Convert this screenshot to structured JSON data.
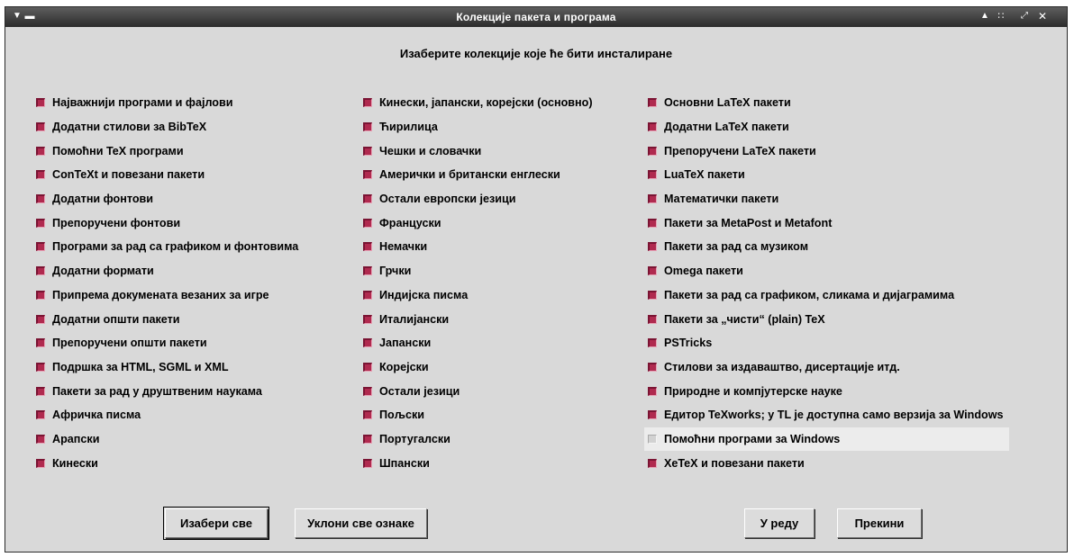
{
  "window": {
    "title": "Колекције пакета и програма",
    "controls": [
      "minimize",
      "maximize",
      "close"
    ]
  },
  "heading": "Изаберите колекције које ће бити инсталиране",
  "columns": [
    [
      {
        "label": "Најважнији програми и фајлови",
        "checked": true
      },
      {
        "label": "Додатни стилови за BibTeX",
        "checked": true
      },
      {
        "label": "Помоћни TeX програми",
        "checked": true
      },
      {
        "label": "ConTeXt и повезани пакети",
        "checked": true
      },
      {
        "label": "Додатни фонтови",
        "checked": true
      },
      {
        "label": "Препоручени фонтови",
        "checked": true
      },
      {
        "label": "Програми за рад са графиком и фонтовима",
        "checked": true
      },
      {
        "label": "Додатни формати",
        "checked": true
      },
      {
        "label": "Припрема докумената везаних за игре",
        "checked": true
      },
      {
        "label": "Додатни општи пакети",
        "checked": true
      },
      {
        "label": "Препоручени општи пакети",
        "checked": true
      },
      {
        "label": "Подршка за HTML, SGML и XML",
        "checked": true
      },
      {
        "label": "Пакети за рад у друштвеним наукама",
        "checked": true
      },
      {
        "label": "Афричка писма",
        "checked": true
      },
      {
        "label": "Арапски",
        "checked": true
      },
      {
        "label": "Кинески",
        "checked": true
      }
    ],
    [
      {
        "label": "Кинески, јапански, корејски (основно)",
        "checked": true
      },
      {
        "label": "Ћирилица",
        "checked": true
      },
      {
        "label": "Чешки и словачки",
        "checked": true
      },
      {
        "label": "Амерички и британски енглески",
        "checked": true
      },
      {
        "label": "Остали европски језици",
        "checked": true
      },
      {
        "label": "Француски",
        "checked": true
      },
      {
        "label": "Немачки",
        "checked": true
      },
      {
        "label": "Грчки",
        "checked": true
      },
      {
        "label": "Индијска писма",
        "checked": true
      },
      {
        "label": "Италијански",
        "checked": true
      },
      {
        "label": "Јапански",
        "checked": true
      },
      {
        "label": "Корејски",
        "checked": true
      },
      {
        "label": "Остали језици",
        "checked": true
      },
      {
        "label": "Пољски",
        "checked": true
      },
      {
        "label": "Португалски",
        "checked": true
      },
      {
        "label": "Шпански",
        "checked": true
      }
    ],
    [
      {
        "label": "Основни LaTeX пакети",
        "checked": true
      },
      {
        "label": "Додатни LaTeX пакети",
        "checked": true
      },
      {
        "label": "Препоручени LaTeX пакети",
        "checked": true
      },
      {
        "label": "LuaTeX пакети",
        "checked": true
      },
      {
        "label": "Математички пакети",
        "checked": true
      },
      {
        "label": "Пакети за MetaPost и Metafont",
        "checked": true
      },
      {
        "label": "Пакети за рад са музиком",
        "checked": true
      },
      {
        "label": "Omega пакети",
        "checked": true
      },
      {
        "label": "Пакети за рад са графиком, сликама и дијаграмима",
        "checked": true
      },
      {
        "label": "Пакети за „чисти“ (plain) TeX",
        "checked": true
      },
      {
        "label": "PSTricks",
        "checked": true
      },
      {
        "label": "Стилови за издаваштво, дисертације итд.",
        "checked": true
      },
      {
        "label": "Природне и компјутерске науке",
        "checked": true
      },
      {
        "label": "Едитор TeXworks; у TL је доступна само верзија за Windows",
        "checked": true
      },
      {
        "label": "Помоћни програми за Windows",
        "checked": false,
        "hover": true
      },
      {
        "label": "XeTeX и повезани пакети",
        "checked": true
      }
    ]
  ],
  "buttons": {
    "select_all": "Изабери све",
    "deselect_all": "Уклони све ознаке",
    "ok": "У реду",
    "cancel": "Прекини"
  },
  "colors": {
    "checked_fill": "#b02a4f",
    "window_bg": "#d9d9d9",
    "titlebar_bg": "#3c3c3c"
  }
}
